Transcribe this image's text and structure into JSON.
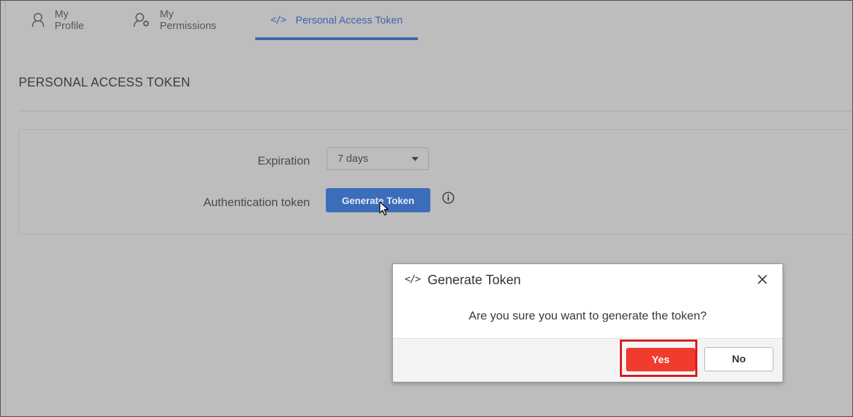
{
  "tabs": [
    {
      "label": "My Profile",
      "icon": "user-icon"
    },
    {
      "label": "My Permissions",
      "icon": "user-gear-icon"
    },
    {
      "label": "Personal Access Token",
      "icon": "code-icon",
      "glyph": "</>",
      "active": true
    }
  ],
  "page": {
    "title": "PERSONAL ACCESS TOKEN"
  },
  "form": {
    "expiration_label": "Expiration",
    "expiration_value": "7 days",
    "auth_label": "Authentication token",
    "generate_label": "Generate Token",
    "info_icon": "info-icon"
  },
  "dialog": {
    "icon_glyph": "</>",
    "title": "Generate Token",
    "message": "Are you sure you want to generate the token?",
    "yes_label": "Yes",
    "no_label": "No"
  },
  "colors": {
    "accent": "#3c63b0",
    "primary_button": "#3c6dbb",
    "danger": "#f23b2f",
    "highlight": "#d9191c",
    "overlay": "#bdbdbd"
  }
}
